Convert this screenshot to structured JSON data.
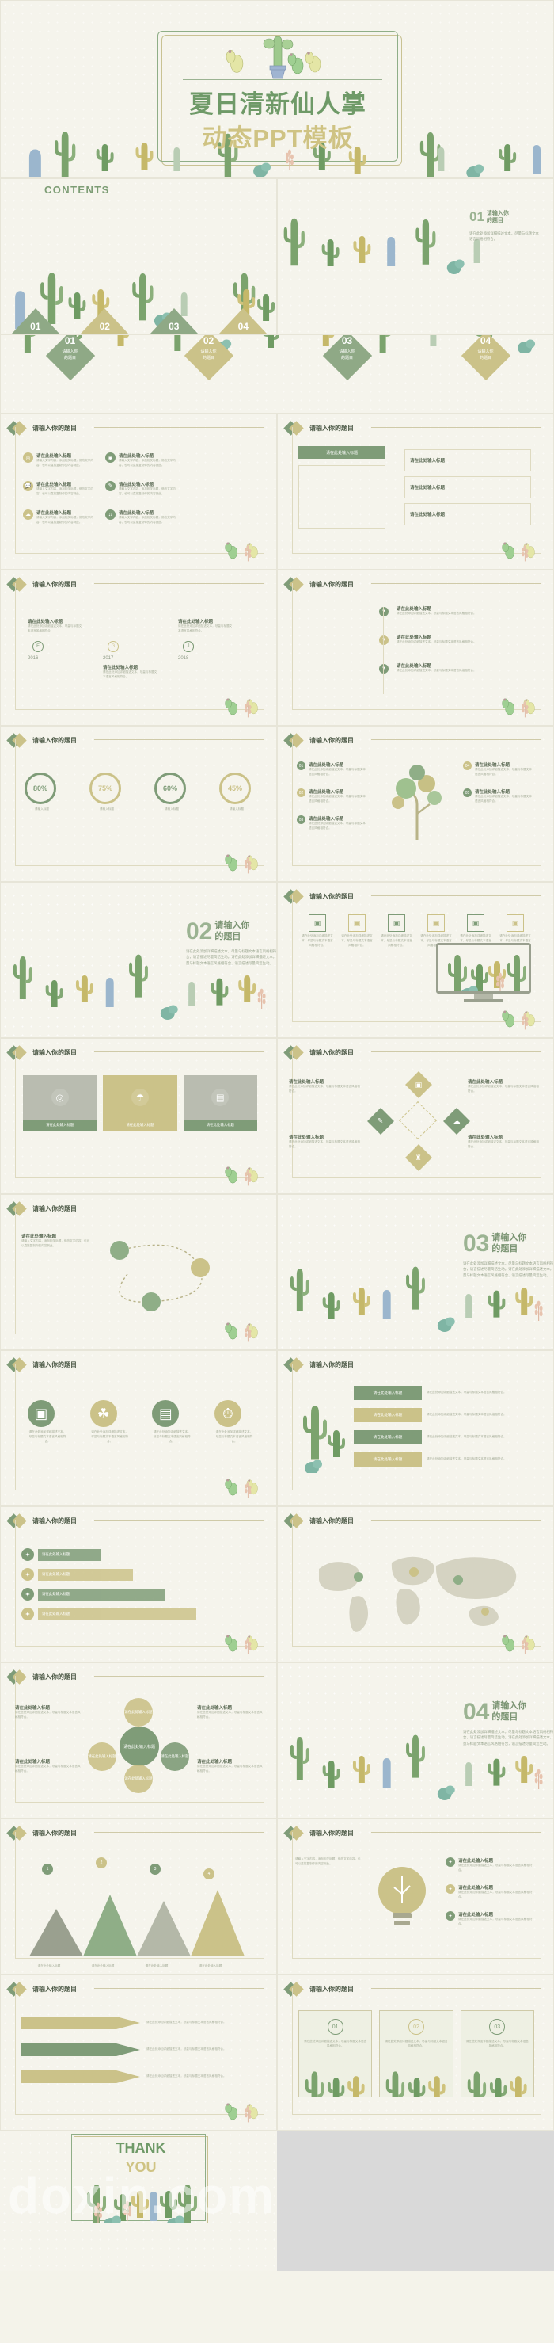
{
  "theme": {
    "bg": "#f4f3ea",
    "slide_bg": "#f5f4ec",
    "green": "#7f9c78",
    "light_green": "#9bb392",
    "gold": "#cbc289",
    "dark_text": "#4d5a47",
    "body_text": "#a6ad99"
  },
  "title_slide": {
    "main_title": "夏日清新仙人掌",
    "sub_title": "动态PPT模板"
  },
  "contents_slide": {
    "label": "CONTENTS",
    "items": [
      {
        "num": "01",
        "caption": "请输入你的题目"
      },
      {
        "num": "02",
        "caption": "请输入你的题目"
      },
      {
        "num": "03",
        "caption": "请输入你的题目"
      },
      {
        "num": "04",
        "caption": "请输入你的题目"
      }
    ]
  },
  "diamond_slide": {
    "items": [
      {
        "num": "01",
        "caption_line1": "请输入你",
        "caption_line2": "的题目"
      },
      {
        "num": "02",
        "caption_line1": "请输入你",
        "caption_line2": "的题目"
      },
      {
        "num": "03",
        "caption_line1": "请输入你",
        "caption_line2": "的题目"
      },
      {
        "num": "04",
        "caption_line1": "请输入你",
        "caption_line2": "的题目"
      }
    ]
  },
  "common": {
    "header_title": "请输入你的题目",
    "item_title": "请在此处输入标题",
    "item_body": "请輸入文字内容，添加相关标题，修改文字内容，也可以直接复制你的内容到此。",
    "short_body": "请在此处添加详细描述文本，尽量与标题文本语言风格相符合。",
    "section_body": "请在此处添加详细描述文本，尽量与标题文本语言风格相符合，语言描述尽量简洁生动。请在此处添加详细描述文本，尽量与标题文本语言风格相符合，语言描述尽量简洁生动。"
  },
  "timeline_slide": {
    "years": [
      "2016",
      "2017",
      "2018"
    ],
    "markers": [
      "F",
      "G",
      "H",
      "J"
    ]
  },
  "percent_slide": {
    "values": [
      "80%",
      "75%",
      "60%",
      "45%"
    ],
    "labels": [
      "请输入标题",
      "请输入标题",
      "请输入标题",
      "请输入标题"
    ]
  },
  "section_dividers": [
    {
      "num": "01",
      "title_line1": "请输入你",
      "title_line2": "的题目"
    },
    {
      "num": "02",
      "title_line1": "请输入你",
      "title_line2": "的题目"
    },
    {
      "num": "03",
      "title_line1": "请输入你",
      "title_line2": "的题目"
    },
    {
      "num": "04",
      "title_line1": "请输入你",
      "title_line2": "的题目"
    }
  ],
  "tree_slide": {
    "nodes": [
      "01",
      "02",
      "03",
      "04",
      "05"
    ]
  },
  "thank_you": {
    "line1": "THANK",
    "line2": "YOU"
  },
  "watermark": "doxin.com"
}
